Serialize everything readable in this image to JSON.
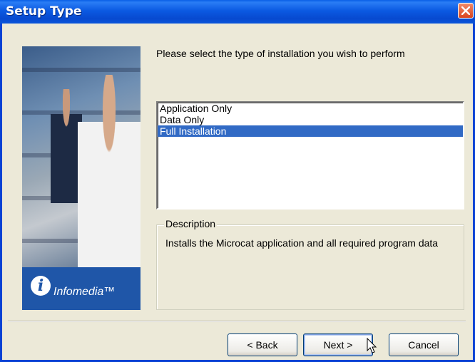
{
  "window": {
    "title": "Setup Type"
  },
  "banner": {
    "logo_letter": "i",
    "logo_text": "Infomedia™"
  },
  "prompt": "Please select the type of installation you wish to perform",
  "install_types": {
    "items": [
      "Application Only",
      "Data Only",
      "Full Installation"
    ],
    "selected": "Full Installation"
  },
  "description": {
    "legend": "Description",
    "text": "Installs the Microcat application and all required program data"
  },
  "buttons": {
    "back": "< Back",
    "next": "Next >",
    "cancel": "Cancel"
  },
  "icons": {
    "close": "close-icon",
    "cursor": "mouse-pointer-icon"
  },
  "colors": {
    "titlebar": "#0842d4",
    "selection": "#316ac5",
    "dialog_bg": "#ece9d8"
  }
}
